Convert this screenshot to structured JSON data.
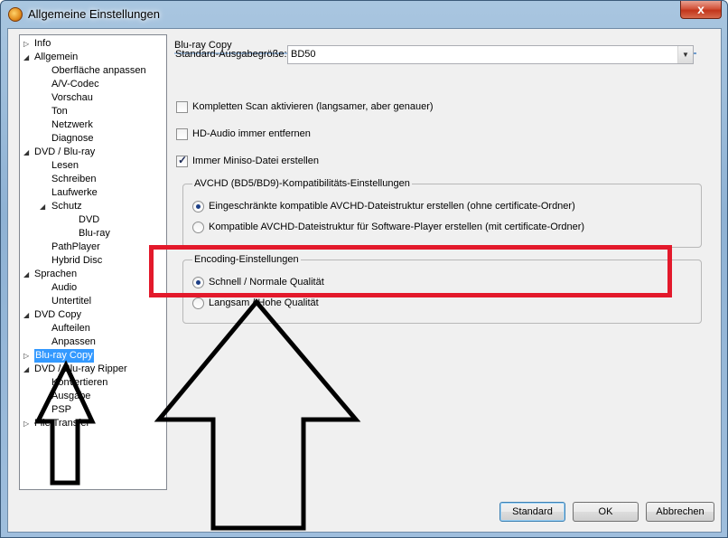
{
  "window": {
    "title": "Allgemeine Einstellungen",
    "close_label": "x"
  },
  "tree": {
    "items": [
      {
        "label": "Info",
        "arrow": "▷"
      },
      {
        "label": "Allgemein",
        "arrow": "◢"
      },
      {
        "label": "Oberfläche anpassen"
      },
      {
        "label": "A/V-Codec"
      },
      {
        "label": "Vorschau"
      },
      {
        "label": "Ton"
      },
      {
        "label": "Netzwerk"
      },
      {
        "label": "Diagnose"
      },
      {
        "label": "DVD / Blu-ray",
        "arrow": "◢"
      },
      {
        "label": "Lesen"
      },
      {
        "label": "Schreiben"
      },
      {
        "label": "Laufwerke"
      },
      {
        "label": "Schutz",
        "arrow": "◢"
      },
      {
        "label": "DVD"
      },
      {
        "label": "Blu-ray"
      },
      {
        "label": "PathPlayer"
      },
      {
        "label": "Hybrid Disc"
      },
      {
        "label": "Sprachen",
        "arrow": "◢"
      },
      {
        "label": "Audio"
      },
      {
        "label": "Untertitel"
      },
      {
        "label": "DVD Copy",
        "arrow": "◢"
      },
      {
        "label": "Aufteilen"
      },
      {
        "label": "Anpassen"
      },
      {
        "label": "Blu-ray Copy",
        "arrow": "▷"
      },
      {
        "label": "DVD / Blu-ray Ripper",
        "arrow": "◢"
      },
      {
        "label": "Konvertieren"
      },
      {
        "label": "Ausgabe"
      },
      {
        "label": "PSP"
      },
      {
        "label": "File Transfer",
        "arrow": "▷"
      }
    ]
  },
  "panel": {
    "section_title": "Blu-ray Copy",
    "output_size_label": "Standard-Ausgabegröße:",
    "output_size_value": "BD50",
    "checkboxes": [
      {
        "label": "Kompletten Scan aktivieren (langsamer, aber genauer)",
        "checked": false
      },
      {
        "label": "HD-Audio immer entfernen",
        "checked": false
      },
      {
        "label": "Immer Miniso-Datei erstellen",
        "checked": true
      }
    ],
    "avchd_group": {
      "legend": "AVCHD (BD5/BD9)-Kompatibilitäts-Einstellungen",
      "options": [
        {
          "label": "Eingeschränkte kompatible AVCHD-Dateistruktur erstellen (ohne certificate-Ordner)",
          "selected": true
        },
        {
          "label": "Kompatible AVCHD-Dateistruktur für Software-Player erstellen (mit certificate-Ordner)",
          "selected": false
        }
      ]
    },
    "encoding_group": {
      "legend": "Encoding-Einstellungen",
      "options": [
        {
          "label": "Schnell / Normale Qualität",
          "selected": true
        },
        {
          "label": "Langsam / Hohe Qualität",
          "selected": false
        }
      ]
    }
  },
  "buttons": {
    "standard": "Standard",
    "ok": "OK",
    "cancel": "Abbrechen"
  },
  "colors": {
    "annotation_red": "#e3192b",
    "selection_blue": "#3399ff"
  }
}
